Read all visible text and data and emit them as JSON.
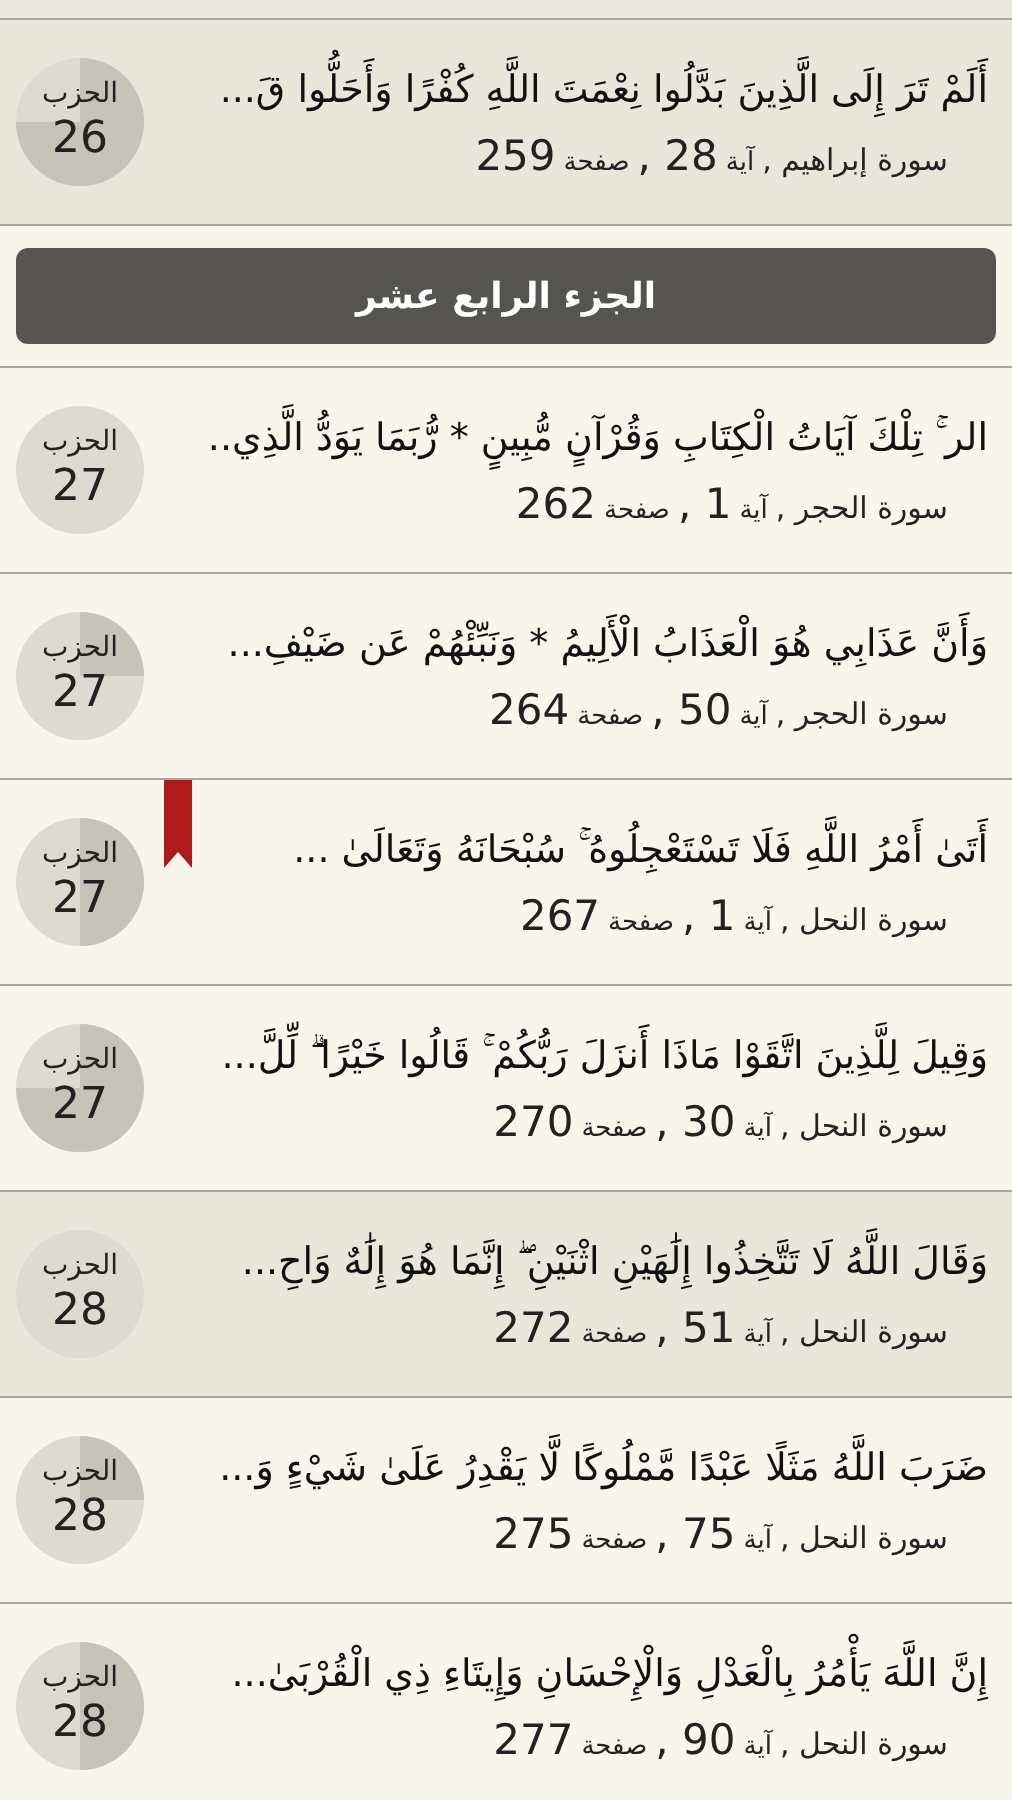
{
  "entries_before": [
    {
      "verse": "أَلَمْ تَرَ إِلَى الَّذِينَ بَدَّلُوا نِعْمَتَ اللَّهِ كُفْرًا وَأَحَلُّوا قَ...",
      "surah": "سورة إبراهيم ,",
      "aya_label": "آية",
      "aya": "28 ,",
      "page_label": "صفحة",
      "page": "259",
      "hizb_label": "الحزب",
      "hizb": "26",
      "kind": "three_quarters",
      "highlighted": true,
      "bookmarked": false
    }
  ],
  "juz_header": "الجزء الرابع عشر",
  "entries": [
    {
      "verse": "الر ۚ تِلْكَ آيَاتُ الْكِتَابِ وَقُرْآنٍ مُّبِينٍ * رُّبَمَا يَوَدُّ الَّذِي..",
      "surah": "سورة الحجر ,",
      "aya_label": "آية",
      "aya": "1 ,",
      "page_label": "صفحة",
      "page": "262",
      "hizb_label": "الحزب",
      "hizb": "27",
      "kind": "empty",
      "highlighted": false,
      "bookmarked": false
    },
    {
      "verse": "وَأَنَّ عَذَابِي هُوَ الْعَذَابُ الْأَلِيمُ * وَنَبِّئْهُمْ عَن ضَيْفِ...",
      "surah": "سورة الحجر ,",
      "aya_label": "آية",
      "aya": "50 ,",
      "page_label": "صفحة",
      "page": "264",
      "hizb_label": "الحزب",
      "hizb": "27",
      "kind": "quarter",
      "highlighted": false,
      "bookmarked": false
    },
    {
      "verse": "أَتَىٰ أَمْرُ اللَّهِ فَلَا تَسْتَعْجِلُوهُ ۚ سُبْحَانَهُ وَتَعَالَىٰ ...",
      "surah": "سورة النحل ,",
      "aya_label": "آية",
      "aya": "1 ,",
      "page_label": "صفحة",
      "page": "267",
      "hizb_label": "الحزب",
      "hizb": "27",
      "kind": "half",
      "highlighted": false,
      "bookmarked": true
    },
    {
      "verse": "وَقِيلَ لِلَّذِينَ اتَّقَوْا مَاذَا أَنزَلَ رَبُّكُمْ ۚ قَالُوا خَيْرًا ۗ لِّلَّ...",
      "surah": "سورة النحل ,",
      "aya_label": "آية",
      "aya": "30 ,",
      "page_label": "صفحة",
      "page": "270",
      "hizb_label": "الحزب",
      "hizb": "27",
      "kind": "three_quarters",
      "highlighted": false,
      "bookmarked": false
    },
    {
      "verse": "وَقَالَ اللَّهُ لَا تَتَّخِذُوا إِلَٰهَيْنِ اثْنَيْنِ ۖ إِنَّمَا هُوَ إِلَٰهٌ وَاحِ...",
      "surah": "سورة النحل ,",
      "aya_label": "آية",
      "aya": "51 ,",
      "page_label": "صفحة",
      "page": "272",
      "hizb_label": "الحزب",
      "hizb": "28",
      "kind": "empty",
      "highlighted": true,
      "bookmarked": false
    },
    {
      "verse": "ضَرَبَ اللَّهُ مَثَلًا عَبْدًا مَّمْلُوكًا لَّا يَقْدِرُ عَلَىٰ شَيْءٍ وَ...",
      "surah": "سورة النحل ,",
      "aya_label": "آية",
      "aya": "75 ,",
      "page_label": "صفحة",
      "page": "275",
      "hizb_label": "الحزب",
      "hizb": "28",
      "kind": "quarter",
      "highlighted": false,
      "bookmarked": false
    },
    {
      "verse": "إِنَّ اللَّهَ يَأْمُرُ بِالْعَدْلِ وَالْإِحْسَانِ وَإِيتَاءِ ذِي الْقُرْبَىٰ...",
      "surah": "سورة النحل ,",
      "aya_label": "آية",
      "aya": "90 ,",
      "page_label": "صفحة",
      "page": "277",
      "hizb_label": "الحزب",
      "hizb": "28",
      "kind": "half",
      "highlighted": false,
      "bookmarked": false
    }
  ]
}
